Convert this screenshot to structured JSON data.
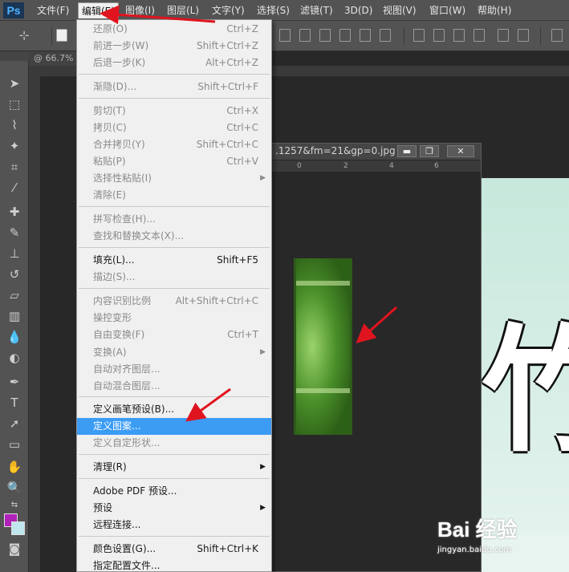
{
  "menubar": {
    "logo": "Ps",
    "items": [
      {
        "label": "文件(F)"
      },
      {
        "label": "编辑(E)"
      },
      {
        "label": "图像(I)"
      },
      {
        "label": "图层(L)"
      },
      {
        "label": "文字(Y)"
      },
      {
        "label": "选择(S)"
      },
      {
        "label": "滤镜(T)"
      },
      {
        "label": "3D(D)"
      },
      {
        "label": "视图(V)"
      },
      {
        "label": "窗口(W)"
      },
      {
        "label": "帮助(H)"
      }
    ]
  },
  "doc_tab": {
    "zoom": "@ 66.7%"
  },
  "doc_window": {
    "title": ".1257&fm=21&gp=0.jpg",
    "ruler_ticks": [
      "0",
      "2",
      "4",
      "6"
    ],
    "minimize": "▬",
    "restore": "❐",
    "close": "✕"
  },
  "bg_doc": {
    "char": "竹"
  },
  "edit_menu": {
    "items": [
      {
        "label": "还原(O)",
        "shortcut": "Ctrl+Z",
        "state": "disabled"
      },
      {
        "label": "前进一步(W)",
        "shortcut": "Shift+Ctrl+Z",
        "state": "disabled"
      },
      {
        "label": "后退一步(K)",
        "shortcut": "Alt+Ctrl+Z",
        "state": "disabled"
      },
      {
        "label": "渐隐(D)...",
        "shortcut": "Shift+Ctrl+F",
        "state": "disabled"
      },
      {
        "label": "剪切(T)",
        "shortcut": "Ctrl+X",
        "state": "disabled"
      },
      {
        "label": "拷贝(C)",
        "shortcut": "Ctrl+C",
        "state": "disabled"
      },
      {
        "label": "合并拷贝(Y)",
        "shortcut": "Shift+Ctrl+C",
        "state": "disabled"
      },
      {
        "label": "粘贴(P)",
        "shortcut": "Ctrl+V",
        "state": "disabled"
      },
      {
        "label": "选择性粘贴(I)",
        "shortcut": "",
        "state": "disabled",
        "submenu": true
      },
      {
        "label": "清除(E)",
        "shortcut": "",
        "state": "disabled"
      },
      {
        "label": "拼写检查(H)...",
        "shortcut": "",
        "state": "disabled"
      },
      {
        "label": "查找和替换文本(X)...",
        "shortcut": "",
        "state": "disabled"
      },
      {
        "label": "填充(L)...",
        "shortcut": "Shift+F5",
        "state": "enabled"
      },
      {
        "label": "描边(S)...",
        "shortcut": "",
        "state": "disabled"
      },
      {
        "label": "内容识别比例",
        "shortcut": "Alt+Shift+Ctrl+C",
        "state": "disabled"
      },
      {
        "label": "操控变形",
        "shortcut": "",
        "state": "disabled"
      },
      {
        "label": "自由变换(F)",
        "shortcut": "Ctrl+T",
        "state": "disabled"
      },
      {
        "label": "变换(A)",
        "shortcut": "",
        "state": "disabled",
        "submenu": true
      },
      {
        "label": "自动对齐图层...",
        "shortcut": "",
        "state": "disabled"
      },
      {
        "label": "自动混合图层...",
        "shortcut": "",
        "state": "disabled"
      },
      {
        "label": "定义画笔预设(B)...",
        "shortcut": "",
        "state": "enabled"
      },
      {
        "label": "定义图案...",
        "shortcut": "",
        "state": "highlight"
      },
      {
        "label": "定义自定形状...",
        "shortcut": "",
        "state": "disabled"
      },
      {
        "label": "清理(R)",
        "shortcut": "",
        "state": "enabled",
        "submenu": true
      },
      {
        "label": "Adobe PDF 预设...",
        "shortcut": "",
        "state": "enabled"
      },
      {
        "label": "预设",
        "shortcut": "",
        "state": "enabled",
        "submenu": true
      },
      {
        "label": "远程连接...",
        "shortcut": "",
        "state": "enabled"
      },
      {
        "label": "颜色设置(G)...",
        "shortcut": "Shift+Ctrl+K",
        "state": "enabled"
      },
      {
        "label": "指定配置文件...",
        "shortcut": "",
        "state": "enabled"
      }
    ]
  },
  "watermark": {
    "logo": "Bai 经验",
    "sub": "jingyan.baidu.com"
  },
  "colors": {
    "foreground": "#b021b7",
    "background": "#bfe5ed",
    "highlight": "#3c9cf4",
    "annotation": "#e0141e"
  }
}
